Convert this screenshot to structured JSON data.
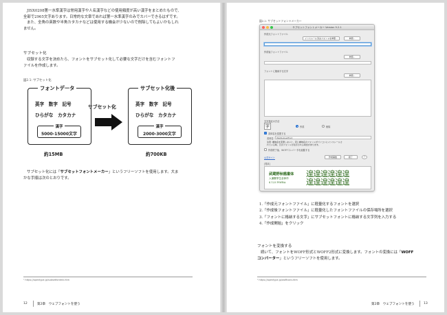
{
  "left_page": {
    "intro_lines": [
      "JISX0208第一水準漢字は常用漢字や人名漢字などの使用頻度が高い漢字をまとめたもので、",
      "全部で2965文字あります。日常的な文章であれば第一水準漢字のみでカバーできるはずです。",
      "また、全角の英数や半角カタカナなどは使用する機会が少ないので削除してもよいかもしれ",
      "ません。"
    ],
    "section_heading": "サブセット化",
    "section_lines": [
      "収録する文字を決めたら、フォントをサブセット化して必要な文字だけを含むフォントフ",
      "ァイルを作成します。"
    ],
    "figure_label": "図2.1: サブセット化",
    "figure": {
      "before": {
        "title": "フォントデータ",
        "row1": "英字　数字　記号",
        "row2": "ひらがな　カタカナ",
        "kanji_title": "漢字",
        "kanji_count": "5000-15000文字",
        "size": "約15MB"
      },
      "arrow_label": "サブセット化",
      "after": {
        "title": "サブセット化後",
        "row1": "英字　数字　記号",
        "row2": "ひらがな　カタカナ",
        "kanji_title": "漢字",
        "kanji_count": "2000-3000文字",
        "size": "約700KB"
      }
    },
    "para3_pre": "サブセット化には「",
    "para3_term": "サブセットフォントメーカー",
    "para3_post": "」というフリーソフトを使用します。大ま",
    "para3_line2": "かな手順は次のとおりです。",
    "footnote": "¹ https://opentype.jp/subsetfontmk.htm",
    "page_number": "12",
    "running_head": "第2章　ウェブフォントを使う"
  },
  "right_page": {
    "figure_label": "図2.2: サブセットフォントメーカー",
    "window": {
      "title": "サブセットフォントメーカー Version 9.2.1",
      "label_src": "作成元フォントファイル",
      "btn_install": "インストール済みフォントを参照...",
      "btn_browse1": "参照...",
      "label_out": "作成後フォントファイル",
      "btn_browse2": "参照...",
      "label_chars": "フォントに格納する文字",
      "btn_browse3": "参照...",
      "label_mode": "文字指定の方法",
      "mode_icon": "字",
      "radio1": "作成",
      "radio2": "削除",
      "check_rename": "書体名を変更する",
      "rename_label": "書体名：",
      "rename_value": "WebSubsetFont",
      "warning_line1": "注意: 書体名を変更しないと、同じ書体名のフォントがパソコンにインストールさ",
      "warning_line2": "れている時、元のフォントが表示される場合があります。",
      "check_woff": "作成終了後、WOFFコンバータを起動する",
      "link_site": "公式サイト",
      "btn_start": "作成開始",
      "btn_end": "終了",
      "label_preview": "[見本]",
      "preview_title": "武蔵野秋楓書体",
      "preview_sub1": "入道雲学生全体作",
      "preview_sub2": "$ 123 FtWBA",
      "preview_glyph_row1": "遑遑遑遑遑遑",
      "preview_glyph_row2": "遑遑遑遑遑遑"
    },
    "steps": [
      "1.「作成元フォントファイル」に軽量化するフォントを選択",
      "2.「作成後フォントファイル」に軽量化したフォントファイルの保存場所を選択",
      "3.「フォントに格納する文字」にサブセットフォントに格納する文字列を入力する",
      "4.「作成開始」をクリック"
    ],
    "section_heading": "フォントを変換する",
    "conv_line1_pre": "続いて、フォントをWOFF形式とWOFF2形式に変換します。フォントの変換には「",
    "conv_term1": "WOFF",
    "conv_term2": "コンバーター",
    "conv_line2_post": "」というフリーソフトを使用します。",
    "footnote": "² https://opentype.jp/woffconv.htm",
    "running_head": "第2章　ウェブフォントを使う",
    "page_number": "13"
  }
}
